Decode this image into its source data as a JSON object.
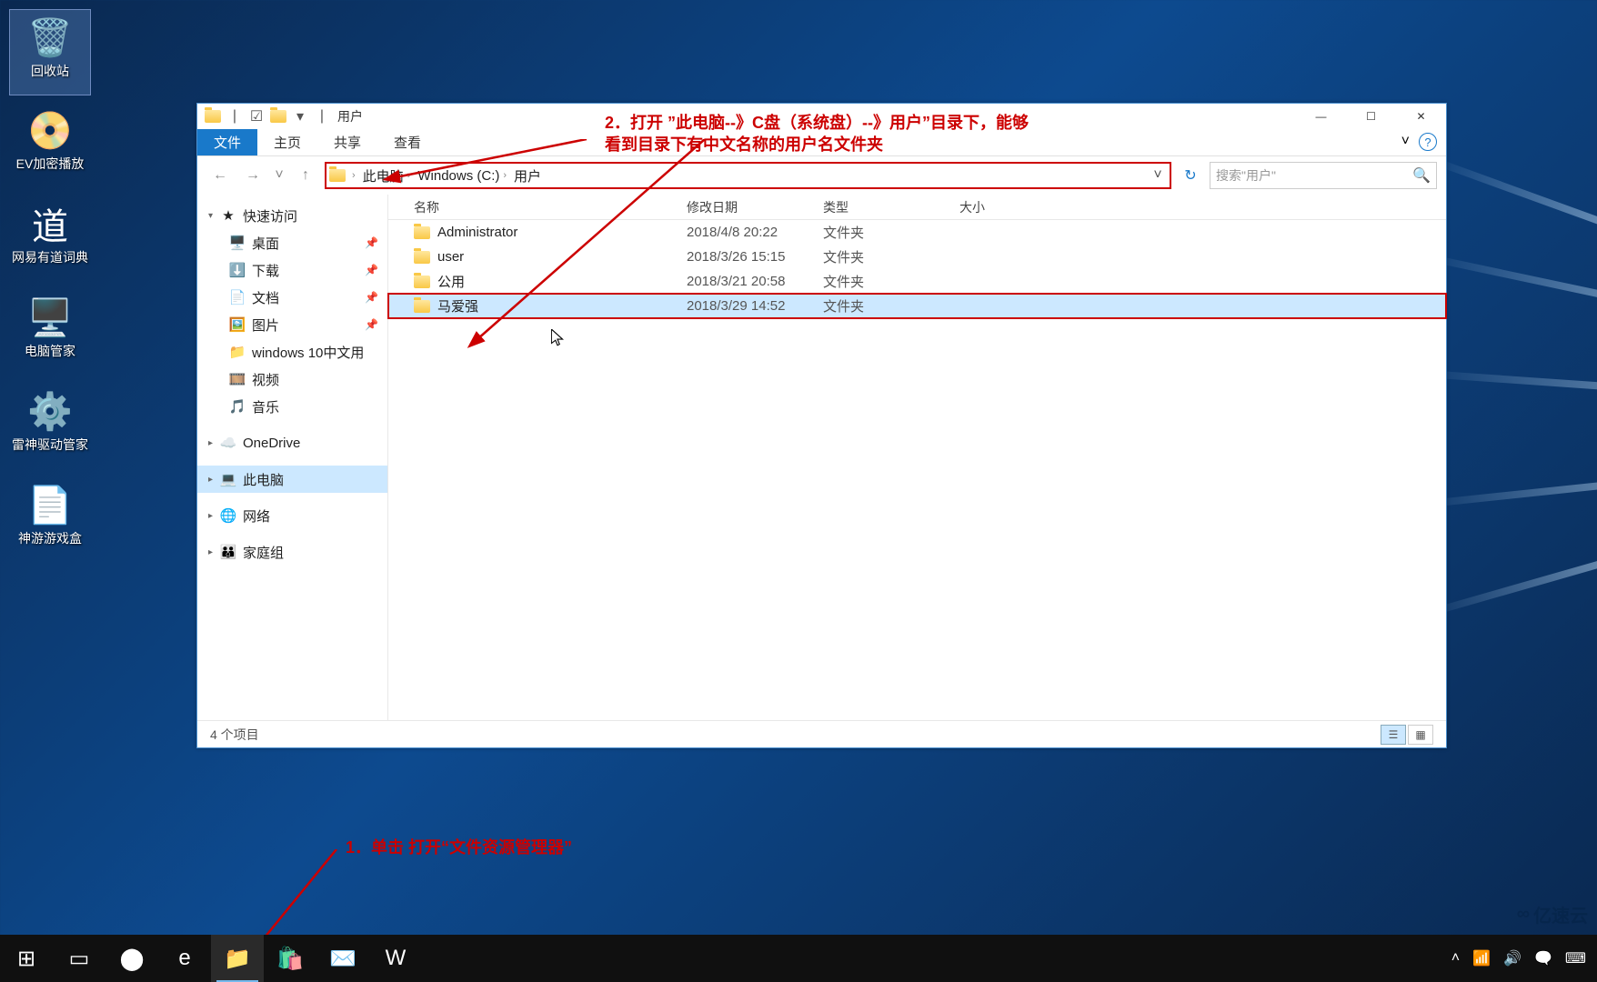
{
  "desktop": {
    "icons": [
      {
        "id": "recycle-bin",
        "label": "回收站",
        "glyph": "🗑️",
        "selected": true
      },
      {
        "id": "ev-player",
        "label": "EV加密播放",
        "glyph": "📀"
      },
      {
        "id": "youdao",
        "label": "网易有道词典",
        "glyph": "道"
      },
      {
        "id": "pc-manager",
        "label": "电脑管家",
        "glyph": "🖥️"
      },
      {
        "id": "thunder-driver",
        "label": "雷神驱动管家",
        "glyph": "⚙️"
      },
      {
        "id": "shenyou",
        "label": "神游游戏盒",
        "glyph": "📄"
      }
    ]
  },
  "window": {
    "title": "用户",
    "controls": {
      "min": "—",
      "max": "☐",
      "close": "✕"
    },
    "ribbon": {
      "file": "文件",
      "tabs": [
        "主页",
        "共享",
        "查看"
      ],
      "expand": "˅",
      "help": "?"
    },
    "nav": {
      "back": "←",
      "fwd": "→",
      "recent": "˅",
      "up": "↑",
      "crumbs": [
        "此电脑",
        "Windows (C:)",
        "用户"
      ],
      "refresh": "↻",
      "search_placeholder": "搜索\"用户\"",
      "search_icon": "🔍"
    },
    "columns": {
      "name": "名称",
      "date": "修改日期",
      "type": "类型",
      "size": "大小"
    },
    "rows": [
      {
        "name": "Administrator",
        "date": "2018/4/8 20:22",
        "type": "文件夹"
      },
      {
        "name": "user",
        "date": "2018/3/26 15:15",
        "type": "文件夹"
      },
      {
        "name": "公用",
        "date": "2018/3/21 20:58",
        "type": "文件夹"
      },
      {
        "name": "马爱强",
        "date": "2018/3/29 14:52",
        "type": "文件夹",
        "selected": true,
        "boxed": true
      }
    ],
    "sidebar": {
      "quick": {
        "label": "快速访问",
        "items": [
          {
            "label": "桌面",
            "glyph": "🖥️",
            "pin": true
          },
          {
            "label": "下载",
            "glyph": "⬇️",
            "pin": true
          },
          {
            "label": "文档",
            "glyph": "📄",
            "pin": true
          },
          {
            "label": "图片",
            "glyph": "🖼️",
            "pin": true
          },
          {
            "label": "windows 10中文用",
            "glyph": "📁"
          },
          {
            "label": "视频",
            "glyph": "🎞️"
          },
          {
            "label": "音乐",
            "glyph": "🎵"
          }
        ]
      },
      "onedrive": {
        "label": "OneDrive",
        "glyph": "☁️"
      },
      "thispc": {
        "label": "此电脑",
        "glyph": "💻",
        "selected": true
      },
      "network": {
        "label": "网络",
        "glyph": "🌐"
      },
      "homegroup": {
        "label": "家庭组",
        "glyph": "👪"
      }
    },
    "status": "4 个项目"
  },
  "annotations": {
    "a1": "1．单击 打开“文件资源管理器”",
    "a2_l1": "2．打开 ”此电脑--》C盘（系统盘）--》用户”目录下，能够",
    "a2_l2": "看到目录下有中文名称的用户名文件夹"
  },
  "taskbar": {
    "items": [
      {
        "id": "start",
        "glyph": "⊞"
      },
      {
        "id": "taskview",
        "glyph": "▭"
      },
      {
        "id": "cortana",
        "glyph": "⬤"
      },
      {
        "id": "edge",
        "glyph": "e"
      },
      {
        "id": "explorer",
        "glyph": "📁",
        "active": true
      },
      {
        "id": "store",
        "glyph": "🛍️"
      },
      {
        "id": "mail",
        "glyph": "✉️"
      },
      {
        "id": "word",
        "glyph": "W"
      }
    ],
    "tray": [
      "˄",
      "📶",
      "🔊",
      "🗨️",
      "⌨"
    ]
  },
  "watermark": "亿速云"
}
